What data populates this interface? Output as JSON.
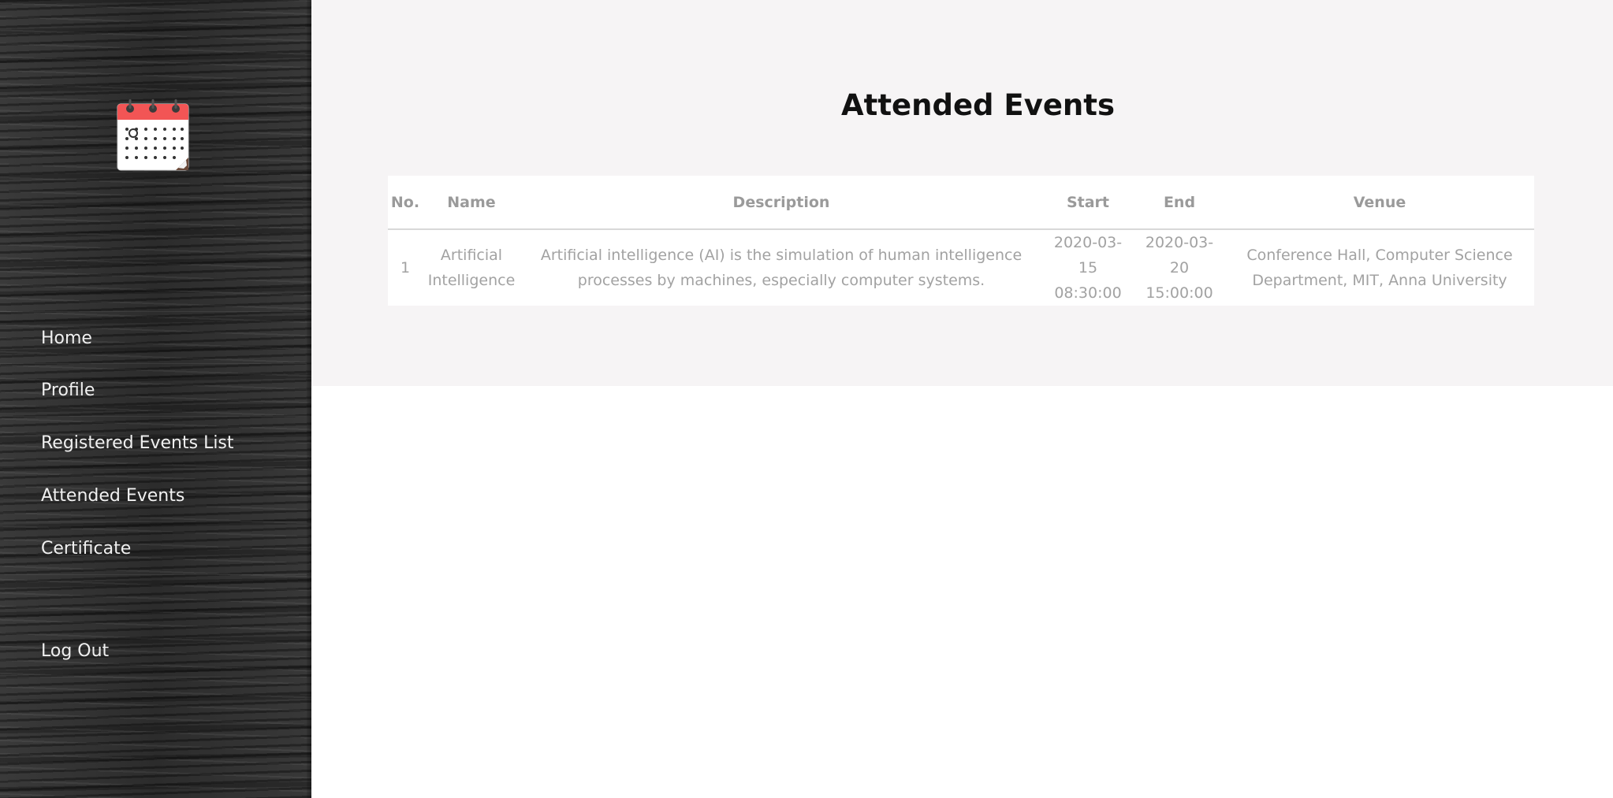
{
  "sidebar": {
    "logo_icon": "calendar-icon",
    "nav": [
      {
        "label": "Home"
      },
      {
        "label": "Profile"
      },
      {
        "label": "Registered Events List"
      },
      {
        "label": "Attended Events"
      },
      {
        "label": "Certificate"
      }
    ],
    "logout_label": "Log Out"
  },
  "main": {
    "title": "Attended Events",
    "table": {
      "headers": [
        "No.",
        "Name",
        "Description",
        "Start",
        "End",
        "Venue"
      ],
      "rows": [
        {
          "no": "1",
          "name": "Artificial Intelligence",
          "description": "Artificial intelligence (AI) is the simulation of human intelligence processes by machines, especially computer systems.",
          "start": "2020-03-15 08:30:00",
          "end": "2020-03-20 15:00:00",
          "venue": "Conference Hall, Computer Science Department, MIT, Anna University"
        }
      ]
    }
  },
  "colors": {
    "calendar_header": "#f25555",
    "page_band": "#f6f4f5",
    "sidebar_text": "#f0f0f0",
    "table_text": "#a2a2a2"
  }
}
